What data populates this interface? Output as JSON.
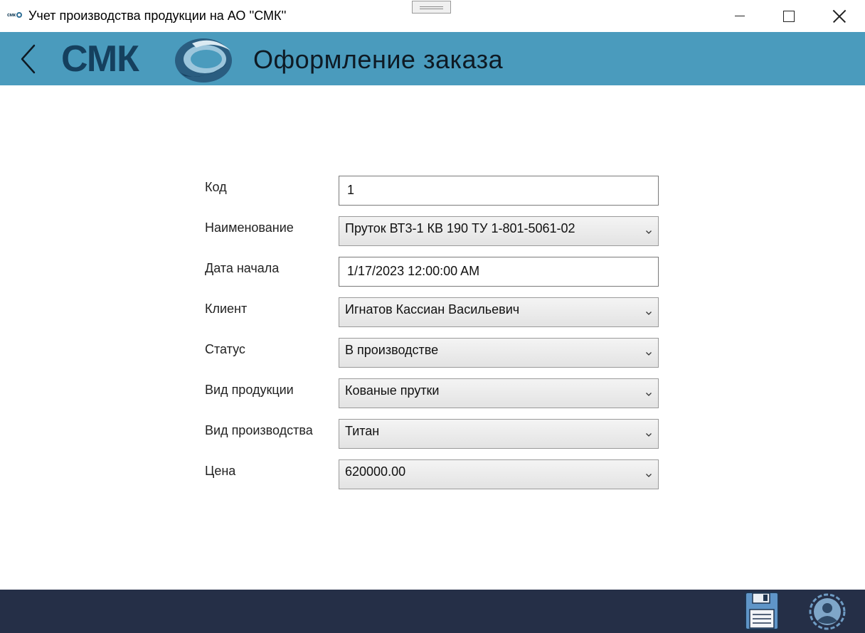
{
  "window": {
    "title": "Учет производства продукции на АО ''СМК''",
    "icon_text": "смк"
  },
  "header": {
    "logo_text": "СМК",
    "page_title": "Оформление заказа"
  },
  "form": {
    "fields": [
      {
        "label": "Код",
        "value": "1",
        "type": "textbox"
      },
      {
        "label": "Наименование",
        "value": "Пруток ВТ3-1 КВ 190 ТУ 1-801-5061-02",
        "type": "combo"
      },
      {
        "label": "Дата начала",
        "value": "1/17/2023 12:00:00 AM",
        "type": "textbox"
      },
      {
        "label": "Клиент",
        "value": "Игнатов Кассиан Васильевич",
        "type": "combo"
      },
      {
        "label": "Статус",
        "value": "В производстве",
        "type": "combo"
      },
      {
        "label": "Вид продукции",
        "value": "Кованые прутки",
        "type": "combo"
      },
      {
        "label": "Вид производства",
        "value": "Титан",
        "type": "combo"
      },
      {
        "label": "Цена",
        "value": "620000.00",
        "type": "combo"
      }
    ]
  },
  "colors": {
    "header_bg": "#4a9bbd",
    "footer_bg": "#252f47",
    "logo_dark": "#15405e"
  },
  "icons": {
    "back": "chevron-left-icon",
    "save": "floppy-disk-icon",
    "profile": "user-profile-icon",
    "dropdown": "chevron-down-icon"
  }
}
